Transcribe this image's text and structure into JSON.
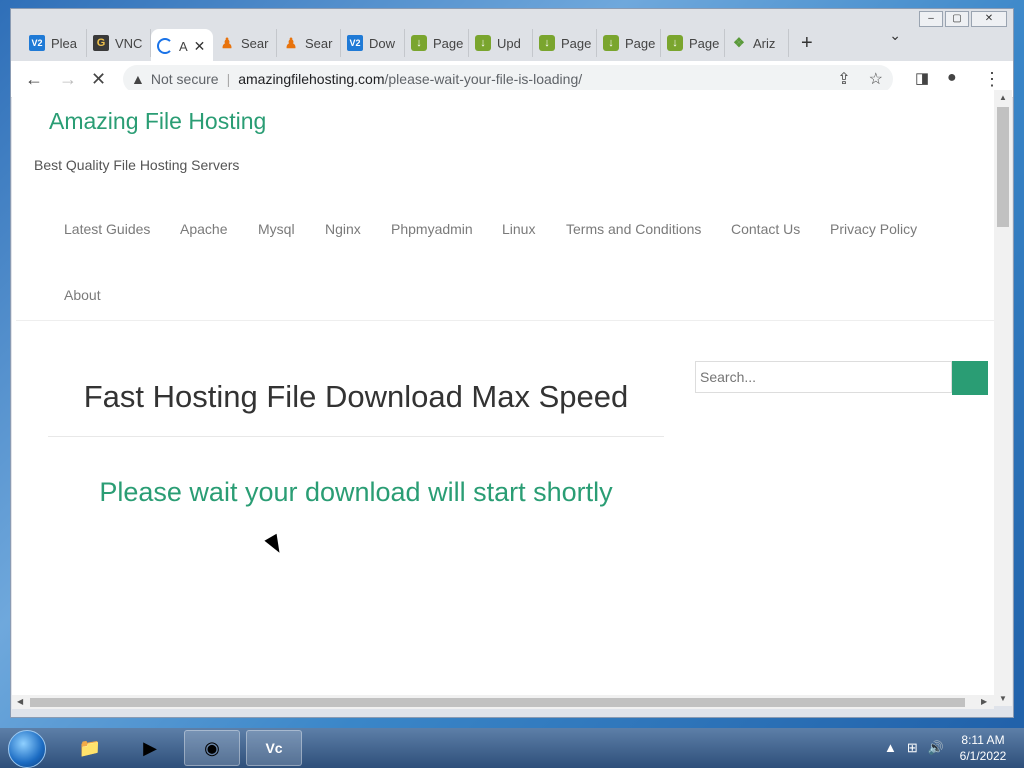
{
  "browser": {
    "tabs": [
      {
        "icon": "v2-icon",
        "label": "Plea"
      },
      {
        "icon": "g-icon",
        "label": "VNC"
      },
      {
        "icon": "loading-spinner-icon",
        "label": "A",
        "active": true
      },
      {
        "icon": "person-icon",
        "label": "Sear"
      },
      {
        "icon": "person-icon",
        "label": "Sear"
      },
      {
        "icon": "v2-icon",
        "label": "Dow"
      },
      {
        "icon": "download-icon",
        "label": "Page"
      },
      {
        "icon": "download-icon",
        "label": "Upd"
      },
      {
        "icon": "download-icon",
        "label": "Page"
      },
      {
        "icon": "download-icon",
        "label": "Page"
      },
      {
        "icon": "download-icon",
        "label": "Page"
      },
      {
        "icon": "ariz-icon",
        "label": "Ariz"
      }
    ],
    "address": {
      "security_label": "Not secure",
      "host": "amazingfilehosting.com",
      "path": "/please-wait-your-file-is-loading/"
    }
  },
  "site": {
    "title": "Amazing File Hosting",
    "tagline": "Best Quality File Hosting Servers",
    "nav": [
      "Latest Guides",
      "Apache",
      "Mysql",
      "Nginx",
      "Phpmyadmin",
      "Linux",
      "Terms and Conditions",
      "Contact Us",
      "Privacy Policy",
      "About"
    ],
    "search_placeholder": "Search..."
  },
  "post": {
    "title": "Fast Hosting File Download Max Speed",
    "message": "Please wait your download will start shortly"
  },
  "taskbar": {
    "time": "8:11 AM",
    "date": "6/1/2022"
  },
  "colors": {
    "accent": "#2a9d74"
  }
}
